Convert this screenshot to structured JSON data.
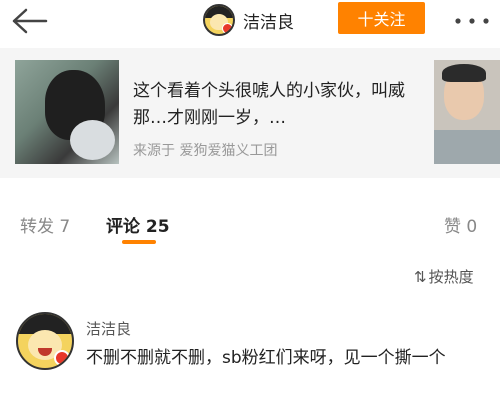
{
  "header": {
    "username": "洁洁良",
    "follow_label": "十关注"
  },
  "shared_card": {
    "text": "这个看着个头很唬人的小家伙，叫威那…才刚刚一岁，…",
    "source": "来源于 爱狗爱猫义工团"
  },
  "tabs": {
    "repost_label": "转发",
    "repost_count": "7",
    "comment_label": "评论",
    "comment_count": "25",
    "like_label": "赞",
    "like_count": "0"
  },
  "sort": {
    "label": "按热度"
  },
  "comment": {
    "author": "洁洁良",
    "text": "不删不删就不删，sb粉红们来呀，见一个撕一个"
  },
  "colors": {
    "accent": "#ff8200",
    "badge": "#e8382a"
  }
}
